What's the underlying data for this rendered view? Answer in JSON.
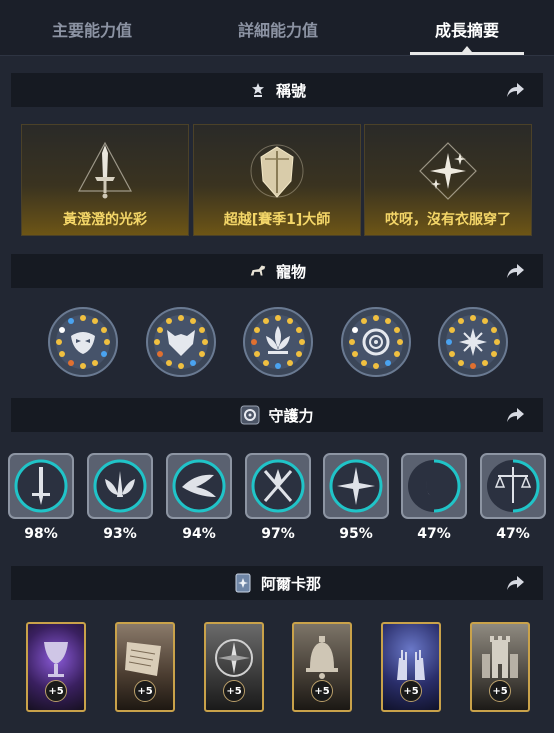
{
  "tabs": [
    {
      "label": "主要能力值"
    },
    {
      "label": "詳細能力值"
    },
    {
      "label": "成長摘要"
    }
  ],
  "active_tab": "成長摘要",
  "sections": {
    "titles": {
      "label": "稱號"
    },
    "pets": {
      "label": "寵物"
    },
    "guardians": {
      "label": "守護力"
    },
    "arcana": {
      "label": "阿爾卡那"
    }
  },
  "titles": [
    {
      "label": "黃澄澄的光彩",
      "icon": "sword-triangle-emblem"
    },
    {
      "label": "超越[賽季1]大師",
      "icon": "shield-crest-emblem"
    },
    {
      "label": "哎呀，沒有衣服穿了",
      "icon": "sparkle-diamond-emblem"
    }
  ],
  "pets": [
    {
      "icon": "mask-pet-icon"
    },
    {
      "icon": "wolf-pet-icon"
    },
    {
      "icon": "lotus-pet-icon"
    },
    {
      "icon": "swirl-pet-icon"
    },
    {
      "icon": "star-pet-icon"
    }
  ],
  "guardians": [
    {
      "percent": "98%",
      "icon": "sword-guardian-icon"
    },
    {
      "percent": "93%",
      "icon": "wings-guardian-icon"
    },
    {
      "percent": "94%",
      "icon": "bird-guardian-icon"
    },
    {
      "percent": "97%",
      "icon": "blades-guardian-icon"
    },
    {
      "percent": "95%",
      "icon": "cross-guardian-icon"
    },
    {
      "percent": "47%",
      "icon": "moon-guardian-icon"
    },
    {
      "percent": "47%",
      "icon": "scales-guardian-icon"
    }
  ],
  "arcana": [
    {
      "badge": "+5",
      "icon": "chalice-card"
    },
    {
      "badge": "+5",
      "icon": "scroll-card"
    },
    {
      "badge": "+5",
      "icon": "compass-card"
    },
    {
      "badge": "+5",
      "icon": "bell-card"
    },
    {
      "badge": "+5",
      "icon": "hands-card"
    },
    {
      "badge": "+5",
      "icon": "tower-card"
    }
  ],
  "colors": {
    "background": "#222733",
    "header": "#161a22",
    "title_gold": "#f4d668",
    "guardian_ring": "#20c4c8",
    "card_border": "#c9a24a"
  }
}
